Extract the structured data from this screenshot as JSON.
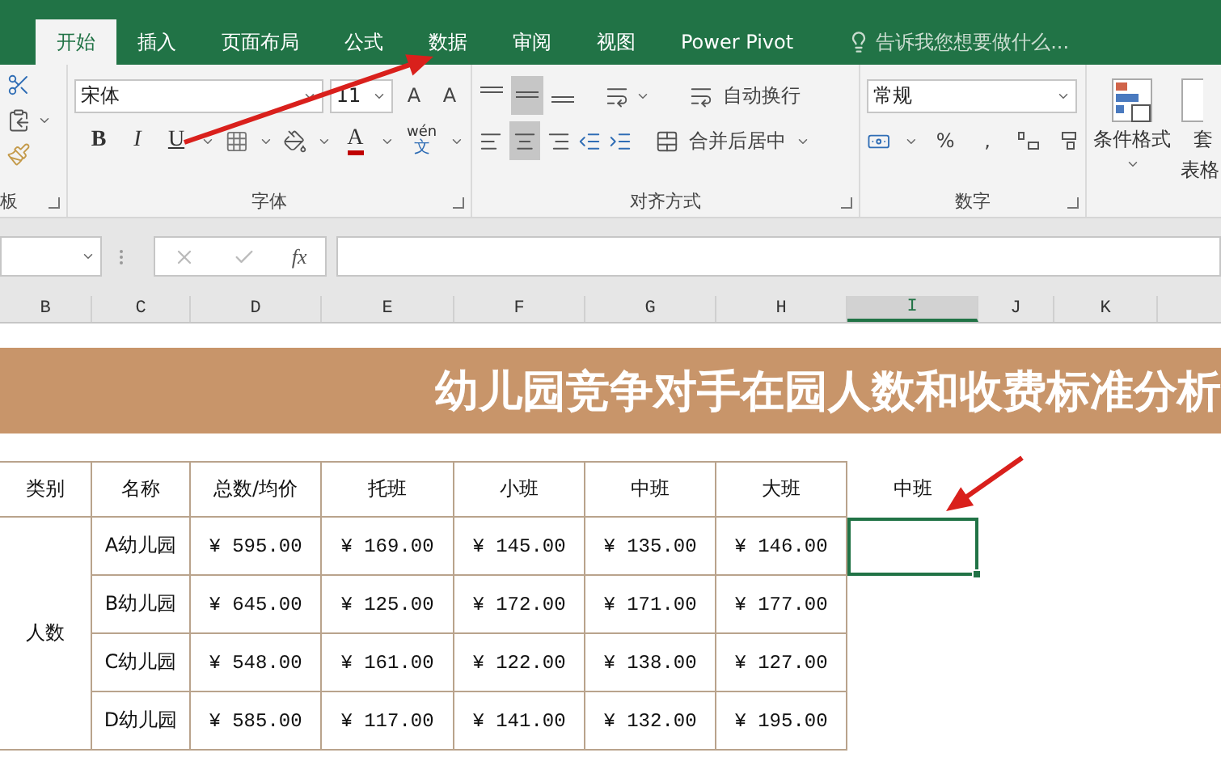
{
  "tabs": [
    {
      "label": "开始",
      "selected": true
    },
    {
      "label": "插入",
      "selected": false
    },
    {
      "label": "页面布局",
      "selected": false
    },
    {
      "label": "公式",
      "selected": false
    },
    {
      "label": "数据",
      "selected": false
    },
    {
      "label": "审阅",
      "selected": false
    },
    {
      "label": "视图",
      "selected": false
    },
    {
      "label": "Power Pivot",
      "selected": false
    }
  ],
  "tell_me": {
    "placeholder": "告诉我您想要做什么..."
  },
  "ribbon": {
    "clipboard": {
      "label": "板"
    },
    "font": {
      "name": "宋体",
      "size": "11",
      "grow": "A",
      "shrink": "A",
      "bold": "B",
      "italic": "I",
      "underline": "U",
      "font_color": "A",
      "phonetic_top": "wén",
      "phonetic_bottom": "文",
      "label": "字体"
    },
    "alignment": {
      "wrap": "自动换行",
      "merge": "合并后居中",
      "label": "对齐方式"
    },
    "number": {
      "format": "常规",
      "percent": "%",
      "comma": ",",
      "label": "数字"
    },
    "styles": {
      "conditional": "条件格式",
      "table_top": "套",
      "table_bottom": "表格"
    }
  },
  "formula_bar": {
    "function": "fx"
  },
  "columns": [
    {
      "label": "B",
      "selected": false
    },
    {
      "label": "C",
      "selected": false
    },
    {
      "label": "D",
      "selected": false
    },
    {
      "label": "E",
      "selected": false
    },
    {
      "label": "F",
      "selected": false
    },
    {
      "label": "G",
      "selected": false
    },
    {
      "label": "H",
      "selected": false
    },
    {
      "label": "I",
      "selected": true
    },
    {
      "label": "J",
      "selected": false
    },
    {
      "label": "K",
      "selected": false
    }
  ],
  "sheet": {
    "banner": "幼儿园竞争对手在园人数和收费标准分析",
    "headers": [
      "类别",
      "名称",
      "总数/均价",
      "托班",
      "小班",
      "中班",
      "大班"
    ],
    "extra_header": "中班",
    "category": "人数",
    "rows": [
      {
        "name": "A幼儿园",
        "values": [
          "¥ 595.00",
          "¥ 169.00",
          "¥ 145.00",
          "¥ 135.00",
          "¥ 146.00"
        ],
        "extra_selected": true
      },
      {
        "name": "B幼儿园",
        "values": [
          "¥ 645.00",
          "¥ 125.00",
          "¥ 172.00",
          "¥ 171.00",
          "¥ 177.00"
        ],
        "extra_selected": false
      },
      {
        "name": "C幼儿园",
        "values": [
          "¥ 548.00",
          "¥ 161.00",
          "¥ 122.00",
          "¥ 138.00",
          "¥ 127.00"
        ],
        "extra_selected": false
      },
      {
        "name": "D幼儿园",
        "values": [
          "¥ 585.00",
          "¥ 117.00",
          "¥ 141.00",
          "¥ 132.00",
          "¥ 195.00"
        ],
        "extra_selected": false
      }
    ]
  }
}
